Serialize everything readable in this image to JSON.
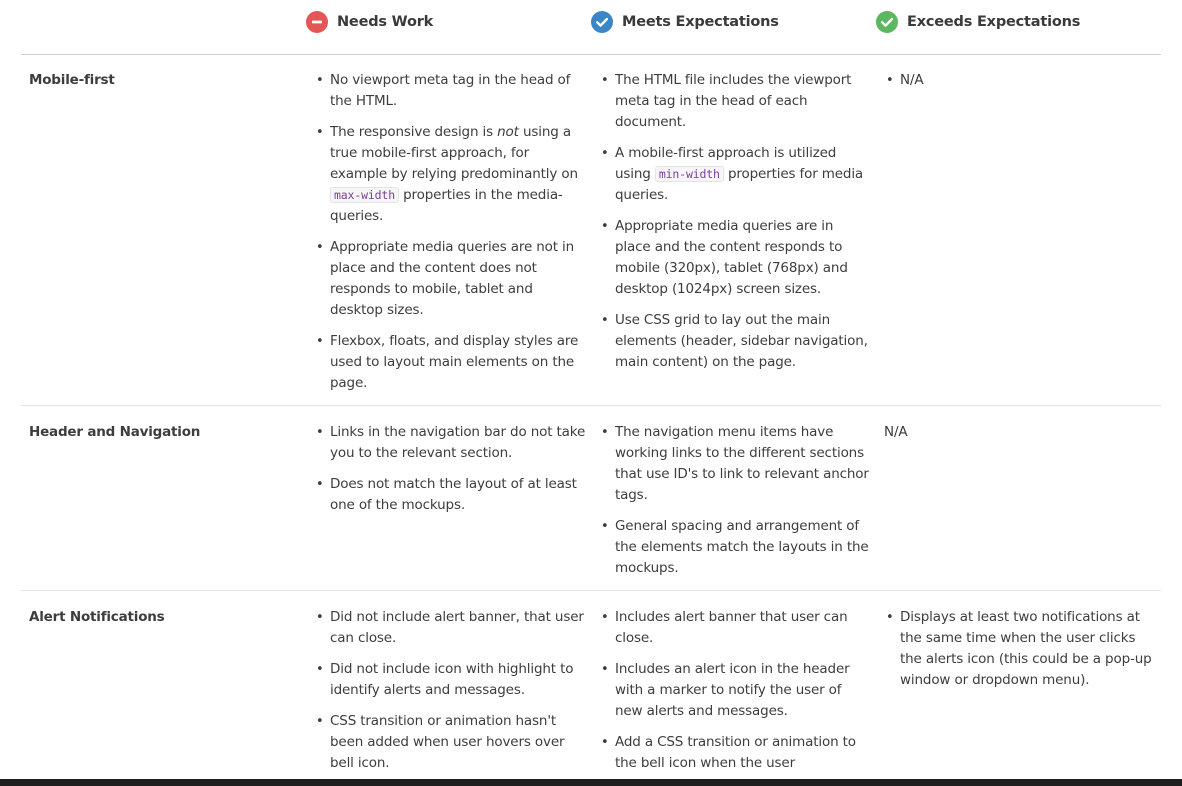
{
  "header": {
    "columns": [
      {
        "label": "Needs Work",
        "icon": "minus-circle-icon",
        "color": "#e45555"
      },
      {
        "label": "Meets Expectations",
        "icon": "check-circle-icon",
        "color": "#3b86c6"
      },
      {
        "label": "Exceeds Expectations",
        "icon": "check-circle-icon",
        "color": "#5cb860"
      }
    ]
  },
  "rows": [
    {
      "title": "Mobile-first",
      "needs_work": [
        "No viewport meta tag in the head of the HTML.",
        {
          "before": "The responsive design is ",
          "em": "not",
          "after": " using a true mobile-first approach, for example by relying predominantly on ",
          "code": "max-width",
          "tail": " properties in the media-queries."
        },
        "Appropriate media queries are not in place and the content does not responds to mobile, tablet and desktop sizes.",
        "Flexbox, floats, and display styles are used to layout main elements on the page."
      ],
      "meets": [
        "The HTML file includes the viewport meta tag in the head of each document.",
        {
          "before": "A mobile-first approach is utilized using ",
          "code": "min-width",
          "tail": " properties for media queries."
        },
        "Appropriate media queries are in place and the content responds to mobile (320px), tablet (768px) and desktop (1024px) screen sizes.",
        "Use CSS grid to lay out the main elements (header, sidebar navigation, main content) on the page."
      ],
      "exceeds": [
        "N/A"
      ]
    },
    {
      "title": "Header and Navigation",
      "needs_work": [
        "Links in the navigation bar do not take you to the relevant section.",
        "Does not match the layout of at least one of the mockups."
      ],
      "meets": [
        "The navigation menu items have working links to the different sections that use ID's to link to relevant anchor tags.",
        "General spacing and arrangement of the elements match the layouts in the mockups."
      ],
      "exceeds_plain": "N/A"
    },
    {
      "title": "Alert Notifications",
      "needs_work": [
        "Did not include alert banner, that user can close.",
        "Did not include icon with highlight to identify alerts and messages.",
        "CSS transition or animation hasn't been added when user hovers over bell icon."
      ],
      "meets": [
        "Includes alert banner that user can close.",
        "Includes an alert icon in the header with a marker to notify the user of new alerts and messages.",
        "Add a CSS transition or animation to the bell icon when the user"
      ],
      "exceeds": [
        "Displays at least two notifications at the same time when the user clicks the alerts icon (this could be a pop-up window or dropdown menu)."
      ]
    }
  ]
}
